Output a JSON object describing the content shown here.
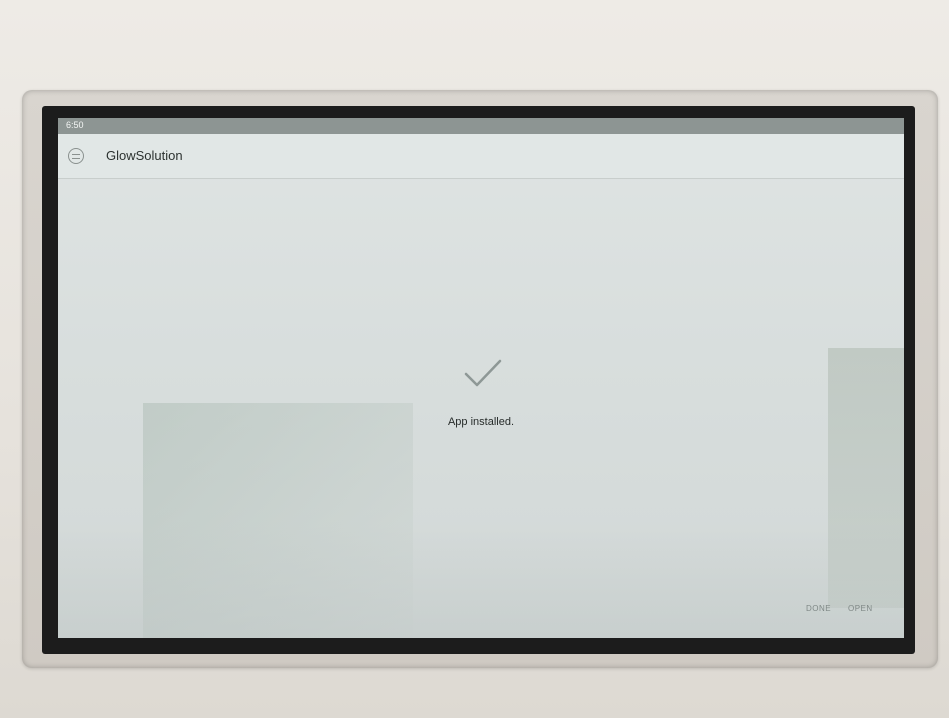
{
  "status_bar": {
    "time": "6:50"
  },
  "app_bar": {
    "icon": "app-logo-icon",
    "title": "GlowSolution"
  },
  "content": {
    "icon": "checkmark-icon",
    "message": "App installed."
  },
  "actions": {
    "done_label": "DONE",
    "open_label": "OPEN"
  },
  "colors": {
    "status_bar": "#8d9593",
    "screen_background": "#dfe4e3",
    "checkmark": "#8e9896",
    "button_text": "#7f8886"
  }
}
